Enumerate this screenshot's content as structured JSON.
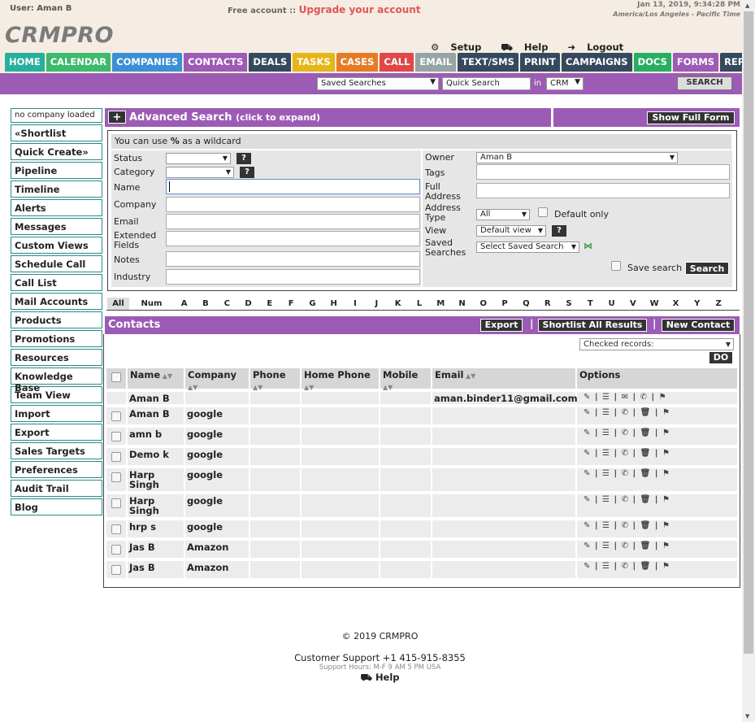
{
  "header": {
    "user_label": "User: Aman B",
    "free_account": "Free account ::",
    "upgrade_link": "Upgrade your account",
    "date": "Jan 13, 2019, 9:34:28 PM",
    "timezone": "America/Los Angeles - Pacific Time",
    "logo": "CRMPRO",
    "setup": "Setup",
    "help": "Help",
    "logout": "Logout"
  },
  "nav": {
    "tabs": [
      {
        "label": "HOME",
        "color": "#27b09d"
      },
      {
        "label": "CALENDAR",
        "color": "#3cba6d"
      },
      {
        "label": "COMPANIES",
        "color": "#3a8fd6"
      },
      {
        "label": "CONTACTS",
        "color": "#9c5bb5"
      },
      {
        "label": "DEALS",
        "color": "#34495e"
      },
      {
        "label": "TASKS",
        "color": "#e6b619"
      },
      {
        "label": "CASES",
        "color": "#e57c25"
      },
      {
        "label": "CALL",
        "color": "#e04848"
      },
      {
        "label": "EMAIL",
        "color": "#95a5a6"
      },
      {
        "label": "TEXT/SMS",
        "color": "#34495e"
      },
      {
        "label": "PRINT",
        "color": "#34495e"
      },
      {
        "label": "CAMPAIGNS",
        "color": "#34495e"
      },
      {
        "label": "DOCS",
        "color": "#27ae60"
      },
      {
        "label": "FORMS",
        "color": "#9c5bb5"
      },
      {
        "label": "REPORTS",
        "color": "#34495e"
      }
    ]
  },
  "searchbar": {
    "saved_searches": "Saved Searches",
    "quick_search_placeholder": "Quick Search",
    "in_label": "in",
    "scope": "CRM",
    "search_button": "SEARCH"
  },
  "sidebar": {
    "items": [
      {
        "label": "no company loaded"
      },
      {
        "label": "«Shortlist"
      },
      {
        "label": "Quick Create»"
      },
      {
        "label": "Pipeline"
      },
      {
        "label": "Timeline"
      },
      {
        "label": "Alerts"
      },
      {
        "label": "Messages"
      },
      {
        "label": "Custom Views"
      },
      {
        "label": "Schedule Call"
      },
      {
        "label": "Call List"
      },
      {
        "label": "Mail Accounts"
      },
      {
        "label": "Products"
      },
      {
        "label": "Promotions"
      },
      {
        "label": "Resources"
      },
      {
        "label": "Knowledge Base"
      },
      {
        "label": "Team View"
      },
      {
        "label": "Import"
      },
      {
        "label": "Export"
      },
      {
        "label": "Sales Targets"
      },
      {
        "label": "Preferences"
      },
      {
        "label": "Audit Trail"
      },
      {
        "label": "Blog"
      }
    ]
  },
  "advanced": {
    "plus": "+",
    "title": "Advanced Search",
    "subtitle": "(click to expand)",
    "show_full_form": "Show Full Form",
    "wildcard_pre": "You can use ",
    "wildcard_sym": "%",
    "wildcard_post": " as a wildcard",
    "status_label": "Status",
    "category_label": "Category",
    "name_label": "Name",
    "company_label": "Company",
    "email_label": "Email",
    "extended_label": "Extended Fields",
    "notes_label": "Notes",
    "industry_label": "Industry",
    "owner_label": "Owner",
    "owner_value": "Aman B",
    "tags_label": "Tags",
    "full_address_label": "Full Address",
    "address_type_label": "Address Type",
    "address_type_value": "All",
    "default_only": "Default only",
    "view_label": "View",
    "view_value": "Default view",
    "saved_searches_label": "Saved Searches",
    "saved_searches_value": "Select Saved Search",
    "save_search": "Save search",
    "search_button": "Search",
    "help_q": "?"
  },
  "alphabet": [
    "All",
    "Num",
    "A",
    "B",
    "C",
    "D",
    "E",
    "F",
    "G",
    "H",
    "I",
    "J",
    "K",
    "L",
    "M",
    "N",
    "O",
    "P",
    "Q",
    "R",
    "S",
    "T",
    "U",
    "V",
    "W",
    "X",
    "Y",
    "Z"
  ],
  "contacts": {
    "title": "Contacts",
    "export": "Export",
    "shortlist_all": "Shortlist All Results",
    "new_contact": "New Contact",
    "checked_records": "Checked records:",
    "do_button": "DO",
    "columns": [
      "Name",
      "Company",
      "Phone",
      "Home Phone",
      "Mobile",
      "Email",
      "Options"
    ],
    "rows": [
      {
        "name": "Aman B",
        "company": "",
        "email": "aman.binder11@gmail.com"
      },
      {
        "name": "Aman B",
        "company": "google",
        "email": ""
      },
      {
        "name": "amn b",
        "company": "google",
        "email": ""
      },
      {
        "name": "Demo k",
        "company": "google",
        "email": ""
      },
      {
        "name": "Harp Singh",
        "company": "google",
        "email": ""
      },
      {
        "name": "Harp Singh",
        "company": "google",
        "email": ""
      },
      {
        "name": "hrp s",
        "company": "google",
        "email": ""
      },
      {
        "name": "Jas B",
        "company": "Amazon",
        "email": ""
      },
      {
        "name": "Jas B",
        "company": "Amazon",
        "email": ""
      }
    ]
  },
  "footer": {
    "copyright": "© 2019 CRMPRO",
    "support": "Customer Support +1 415-915-8355",
    "hours": "Support Hours: M-F 9 AM 5 PM USA",
    "help": "Help"
  }
}
